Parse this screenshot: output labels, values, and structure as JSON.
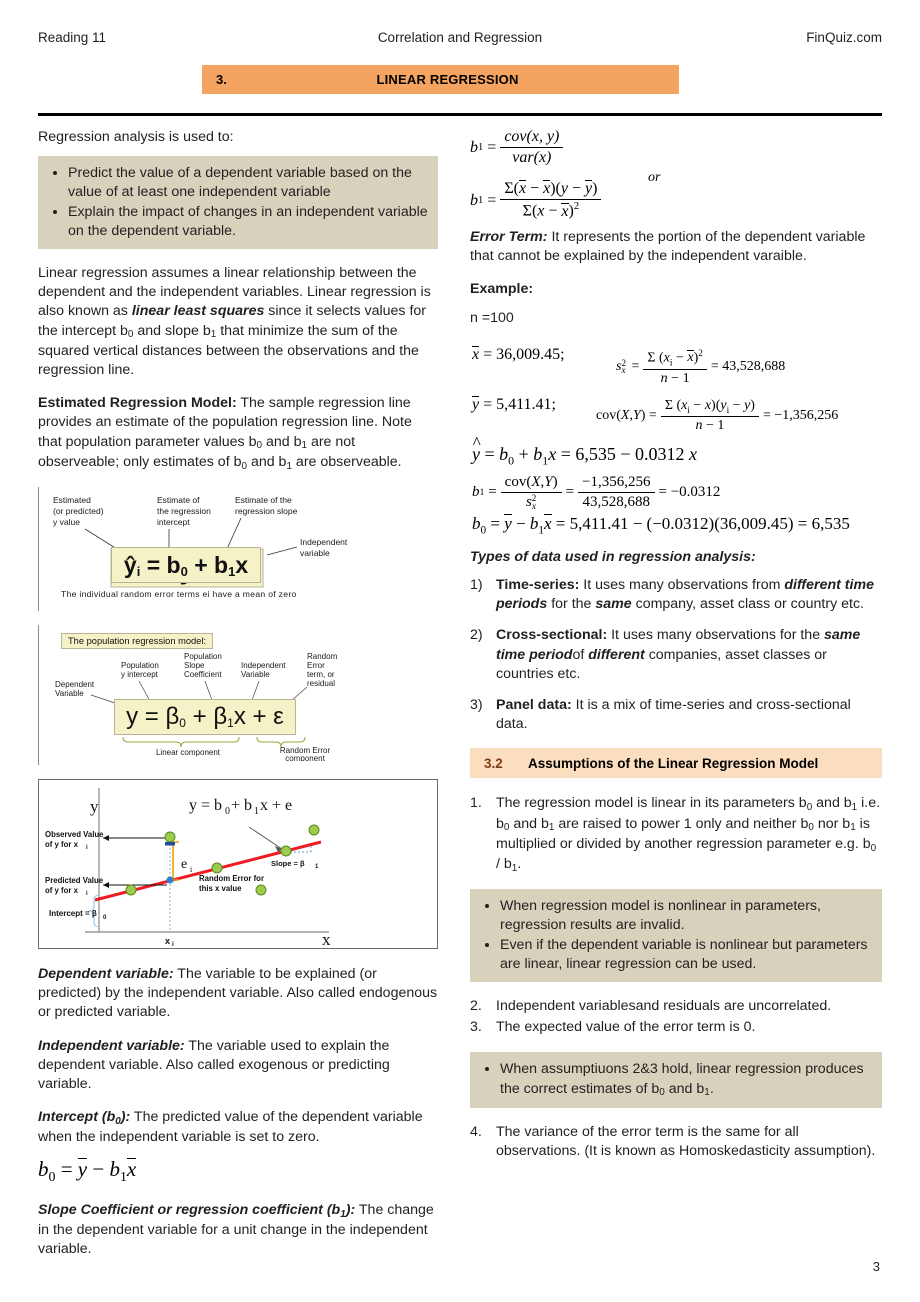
{
  "header": {
    "reading": "Reading 11",
    "topic": "Correlation and Regression",
    "brand": "FinQuiz.com"
  },
  "section": {
    "number": "3.",
    "title": "LINEAR REGRESSION",
    "band_color": "#f4a460"
  },
  "left": {
    "intro": "Regression analysis is used to:",
    "callout1": [
      "Predict the value of a dependent variable based on the value of at least one independent variable",
      "Explain the impact of changes in an independent variable on the dependent variable."
    ],
    "para_linear": {
      "a": "Linear regression assumes a linear relationship between the dependent and the independent variables. Linear regression is also known as ",
      "em": "linear least squares",
      "b": " since it selects values for the intercept b",
      "sub1": "0",
      "c": " and slope b",
      "sub2": "1",
      "d": " that minimize the sum of the squared vertical distances between the observations and the regression line."
    },
    "estimated_model": {
      "term": "Estimated Regression Model:",
      "a": " The sample regression line provides an estimate of the population regression line. Note that population parameter values b",
      "s1": "0",
      "b": " and b",
      "s2": "1",
      "c": " are not observeable; only estimates of b",
      "s3": "0",
      "d": " and b",
      "s4": "1",
      "e": " are observeable."
    },
    "figure1": {
      "callout_a": "Estimated (or predicted) y value",
      "callout_b": "Estimate of the regression intercept",
      "callout_c": "Estimate of the regression slope",
      "callout_d": "Independent variable",
      "equation": "ŷi = b0 + b1x",
      "footnote": "The individual random error terms  ei  have a mean of zero"
    },
    "figure2": {
      "title": "The population regression model:",
      "callout_dependent": "Dependent Variable",
      "callout_intercept": "Population y intercept",
      "callout_slope": "Population Slope Coefficient",
      "callout_independent": "Independent Variable",
      "callout_error": "Random Error term, or residual",
      "equation": "y = β0 + β1x + ε",
      "brace_linear": "Linear component",
      "brace_error": "Random Error component"
    },
    "figure3": {
      "equation": "y = b0 + b1x + e",
      "y_axis": "y",
      "x_axis": "x",
      "observed": "Observed Value of y for xi",
      "predicted": "Predicted Value of y for xi",
      "error_term": "ei",
      "random_error": "Random Error for this x value",
      "slope": "Slope = β1",
      "intercept": "Intercept = β0",
      "xi": "xi"
    },
    "dependent_variable": {
      "term": "Dependent variable:",
      "text": " The variable to be explained (or predicted) by the independent variable. Also called endogenous or predicted variable."
    },
    "independent_variable": {
      "term": "Independent variable:",
      "text": " The variable used to explain the dependent variable. Also called exogenous or predicting variable."
    },
    "intercept": {
      "term": "Intercept (b",
      "sub": "0",
      "term_end": "):",
      "text": " The predicted value of the dependent variable when the independent variable is set to zero."
    },
    "intercept_formula": "b0 = ȳ − b1x̄",
    "slope_coefficient": {
      "term": "Slope Coefficient or regression coefficient (b",
      "sub": "1",
      "term_end": "):",
      "text": " The change in the dependent variable for a unit change in the independent variable."
    }
  },
  "right": {
    "b1_formula_1": "b1 = cov(x,y) / var(x)",
    "or_label": "or",
    "b1_formula_2": "b1 = Σ(x − x̄)(y − ȳ) / Σ(x − x̄)²",
    "error_term": {
      "term": "Error Term:",
      "text": " It represents the portion of the dependent variable that cannot be explained by the independent varaible."
    },
    "example_label": "Example:",
    "n_value": "n =100",
    "example_math": {
      "xbar": "x̄ = 36,009.45;",
      "sx2_label": "sx²",
      "sx2_num": "Σ (xi − x̄)²",
      "sx2_den": "n − 1",
      "sx2_value": "= 43,528,688",
      "ybar": "ȳ = 5,411.41;",
      "cov_label": "cov(X,Y) =",
      "cov_num": "Σ (xi − x)(yi − y)",
      "cov_den": "n − 1",
      "cov_value": "= −1,356,256",
      "yhat": "ŷ = b0 + b1x = 6,535 − 0.0312 x",
      "b1_line": "b1 = cov(X,Y) / sx² = −1,356,256 / 43,528,688 = −0.0312",
      "b1_num": "cov(X,Y)",
      "b1_den": "sx²",
      "b1_num2": "−1,356,256",
      "b1_den2": "43,528,688",
      "b1_result": "= −0.0312",
      "b0_line": "b0 = ȳ − b1x̄ = 5,411.41 − (−0.0312)(36,009.45) = 6,535"
    },
    "types_title": "Types of data used in regression analysis:",
    "types": [
      {
        "mark": "1)",
        "term": "Time-series:",
        "p1": " It uses many observations from ",
        "em1": "different time periods",
        "p2": " for the ",
        "em2": "same",
        "p3": " company, asset class or country etc."
      },
      {
        "mark": "2)",
        "term": "Cross-sectional:",
        "p1": " It uses many observations for the ",
        "em1": "same time period",
        "p2": "of ",
        "em2": "different",
        "p3": " companies, asset classes or  countries etc."
      },
      {
        "mark": "3)",
        "term": "Panel data:",
        "p1": " It is a mix of time-series and cross-sectional data.",
        "em1": "",
        "p2": "",
        "em2": "",
        "p3": ""
      }
    ],
    "subsection": {
      "number": "3.2",
      "title": "Assumptions of the Linear Regression Model",
      "band_color": "#fbddc0"
    },
    "assumption1": {
      "mark": "1.",
      "a": "The regression model is linear in its parameters b",
      "s1": "0",
      "b": " and b",
      "s2": "1",
      "c": " i.e. b",
      "s3": "0",
      "d": " and b",
      "s4": "1",
      "e": " are raised to power 1 only and neither b",
      "s5": "0",
      "f": " nor b",
      "s6": "1",
      "g": " is multiplied or divided by another regression parameter e.g. b",
      "s7": "0",
      "h": " / b",
      "s8": "1",
      "i": "."
    },
    "callout_nonlinear": [
      "When regression model is nonlinear in parameters, regression results are invalid.",
      "Even if the dependent variable is nonlinear but parameters are linear, linear regression can be used."
    ],
    "assumption2": {
      "mark": "2.",
      "text": "Independent variablesand residuals are uncorrelated."
    },
    "assumption3": {
      "mark": "3.",
      "text": "The expected value of the error term is 0."
    },
    "callout_assumptions": {
      "a": "When assumptiuons 2&3 hold,  linear regression produces the correct estimates of b",
      "s1": "0",
      "b": " and b",
      "s2": "1",
      "c": "."
    },
    "assumption4": {
      "mark": "4.",
      "text": "The variance of the error term is the same for all observations. (It is known as Homoskedasticity assumption)."
    }
  },
  "footer": {
    "page": "3"
  }
}
